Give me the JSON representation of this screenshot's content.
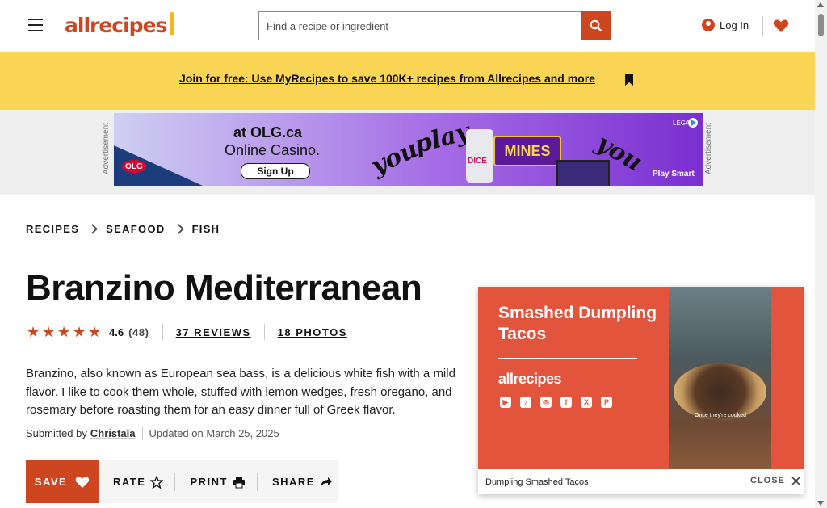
{
  "header": {
    "logo_text": "allrecipes",
    "search_placeholder": "Find a recipe or ingredient",
    "login_label": "Log In",
    "brand_color": "#ce4620"
  },
  "promo": {
    "text": "Join for free: Use MyRecipes to save 100K+ recipes from Allrecipes and more"
  },
  "ad": {
    "side_label": "Advertisement",
    "line1": "at OLG.ca",
    "line2": "Online Casino.",
    "cta": "Sign Up",
    "word_you": "you",
    "word_play": "play",
    "word_you2": "you",
    "game": "MINES",
    "game2": "DICE",
    "brand": "OLG",
    "tagline": "Play Smart",
    "legal": "LEGAL"
  },
  "breadcrumbs": [
    "Recipes",
    "Seafood",
    "Fish"
  ],
  "recipe": {
    "title": "Branzino Mediterranean",
    "rating": "4.6",
    "rating_count": "(48)",
    "reviews_label": "37 REVIEWS",
    "photos_label": "18 PHOTOS",
    "description": "Branzino, also known as European sea bass, is a delicious white fish with a mild flavor. I like to cook them whole, stuffed with lemon wedges, fresh oregano, and rosemary before roasting them for an easy dinner full of Greek flavor.",
    "submitted_by": "Submitted by",
    "author": "Christala",
    "updated": "Updated on March 25, 2025"
  },
  "actions": {
    "save": "SAVE",
    "rate": "RATE",
    "print": "PRINT",
    "share": "SHARE"
  },
  "video": {
    "title": "Smashed Dumpling Tacos",
    "logo": "allrecipes",
    "inner_caption": "Once they're cooked",
    "caption": "Dumpling Smashed Tacos",
    "close_label": "CLOSE",
    "socials": [
      "youtube-icon",
      "tiktok-icon",
      "instagram-icon",
      "facebook-icon",
      "x-icon",
      "pinterest-icon"
    ]
  }
}
